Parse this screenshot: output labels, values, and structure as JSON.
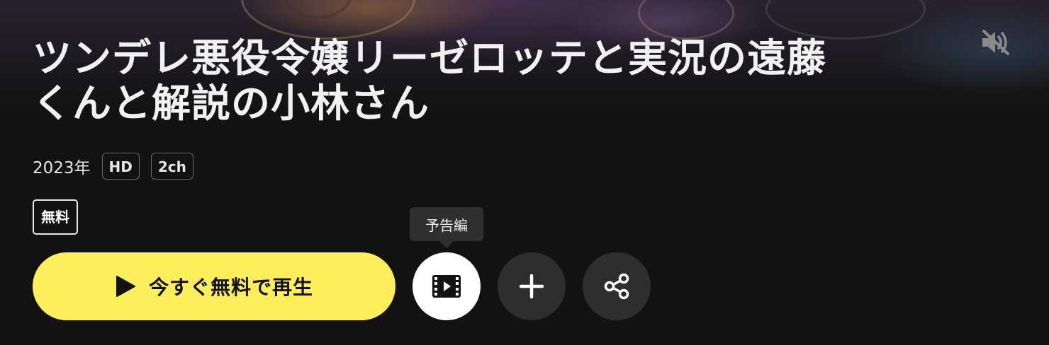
{
  "header": {
    "title_line1": "ツンデレ悪役令嬢リーゼロッテと実況の遠藤",
    "title_line2": "くんと解説の小林さん",
    "mute_icon": "speaker-muted-icon"
  },
  "meta": {
    "year": "2023年",
    "quality": "HD",
    "audio": "2ch"
  },
  "badge": {
    "free": "無料"
  },
  "actions": {
    "play_label": "今すぐ無料で再生",
    "play_icon": "play-icon",
    "trailer_tooltip": "予告編",
    "trailer_icon": "film-icon",
    "add_icon": "plus-icon",
    "share_icon": "share-icon"
  },
  "colors": {
    "background": "#121212",
    "play_button": "#fdee5a",
    "circle_button": "#2e2e2e",
    "trailer_button": "#ffffff"
  }
}
